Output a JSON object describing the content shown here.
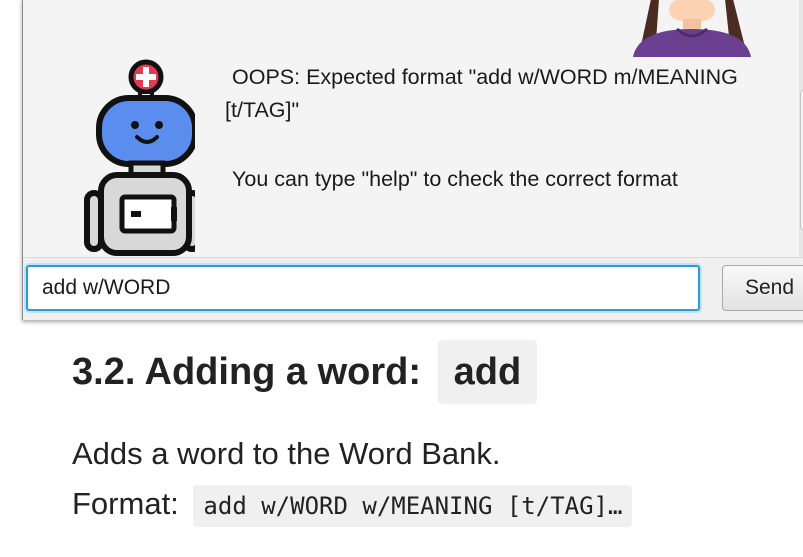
{
  "dialog": {
    "bot_message": {
      "line1": "OOPS: Expected format \"add w/WORD m/MEANING",
      "line2": "[t/TAG]\"",
      "line3": "You can type \"help\" to check the correct format"
    }
  },
  "input": {
    "value": "add w/WORD",
    "send_label": "Send"
  },
  "doc": {
    "heading_text": "3.2. Adding a word:",
    "heading_code": "add",
    "description": "Adds a word to the Word Bank.",
    "format_label": "Format:",
    "format_code": "add w/WORD w/MEANING [t/TAG]…"
  },
  "colors": {
    "input_focus": "#2a9bd7",
    "bot_face": "#5b8def",
    "bot_cross": "#e23a52",
    "user_shirt": "#6a3f8f"
  },
  "icons": {
    "bot": "robot-avatar-icon",
    "user": "user-avatar-icon"
  }
}
